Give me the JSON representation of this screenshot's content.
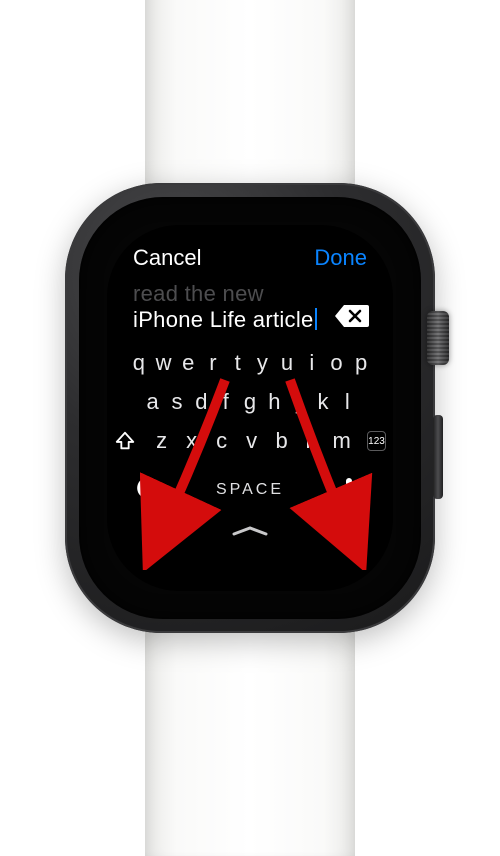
{
  "header": {
    "cancel_label": "Cancel",
    "done_label": "Done"
  },
  "text_entry": {
    "previous_line": "read the new",
    "current_line": "iPhone Life article"
  },
  "keyboard": {
    "row1": [
      "q",
      "w",
      "e",
      "r",
      "t",
      "y",
      "u",
      "i",
      "o",
      "p"
    ],
    "row2": [
      "a",
      "s",
      "d",
      "f",
      "g",
      "h",
      "j",
      "k",
      "l"
    ],
    "row3": [
      "z",
      "x",
      "c",
      "v",
      "b",
      "n",
      "m"
    ],
    "numeric_label": "123",
    "space_label": "SPACE"
  },
  "colors": {
    "accent": "#0a84ff",
    "annotation": "#d40c0c"
  }
}
